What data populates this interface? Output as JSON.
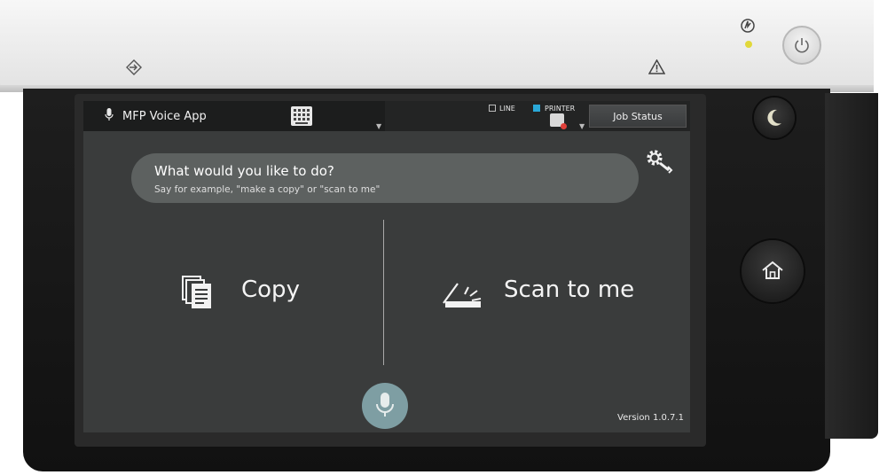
{
  "status_bar": {
    "app_title": "MFP Voice App",
    "line_label": "LINE",
    "printer_label": "PRINTER",
    "job_status_label": "Job Status"
  },
  "prompt": {
    "title": "What would you like to do?",
    "hint": "Say for example, \"make a copy\" or \"scan to me\""
  },
  "options": {
    "copy_label": "Copy",
    "scan_label": "Scan to me"
  },
  "footer": {
    "version": "Version 1.0.7.1"
  },
  "icons": {
    "mic": "microphone-icon",
    "keypad": "keypad-icon",
    "settings": "gear-wrench-icon",
    "copy": "copy-documents-icon",
    "scan": "scanner-icon",
    "home": "home-icon",
    "sleep": "moon-icon",
    "power": "power-icon",
    "warning": "warning-icon",
    "data": "data-arrow-icon"
  },
  "colors": {
    "screen_bg": "#3a3c3c",
    "prompt_bg": "#5d6160",
    "mic_button": "#7e9ea3",
    "printer_indicator": "#2aa8d8",
    "led": "#e1d83a"
  }
}
